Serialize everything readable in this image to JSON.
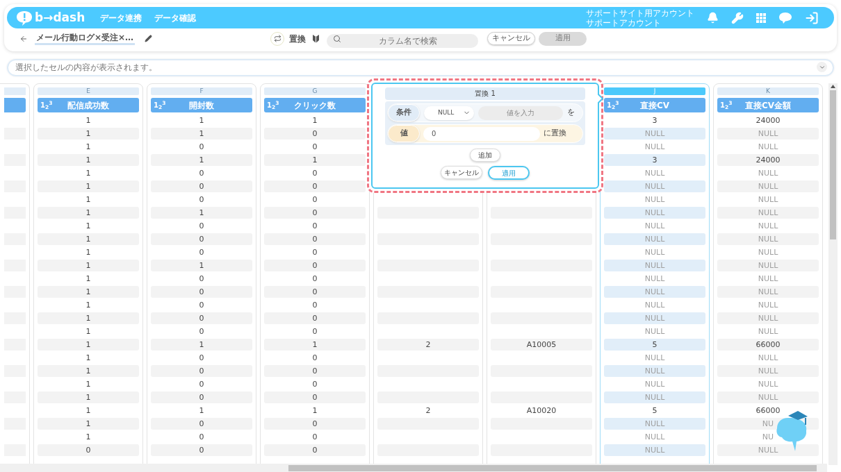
{
  "header": {
    "logo": "b→dash",
    "nav": [
      {
        "label": "データ連携"
      },
      {
        "label": "データ確認"
      }
    ],
    "account": [
      "サポートサイト用アカウント",
      "サポートアカウント"
    ]
  },
  "toolbar": {
    "title": "メール行動ログ×受注×…",
    "replace_label": "置換",
    "search": {
      "placeholder": "カラム名で検索"
    },
    "cancel": "キャンセル",
    "apply": {
      "label": "適用",
      "disabled": true
    }
  },
  "formula_bar": {
    "placeholder": "選択したセルの内容が表示されます。"
  },
  "columns": [
    {
      "letter": "E",
      "name": "配信成功数",
      "type_badge": "1$_{2}$$^{3}$",
      "selected": false,
      "cells": [
        "1",
        "1",
        "1",
        "1",
        "1",
        "1",
        "1",
        "1",
        "1",
        "1",
        "1",
        "1",
        "1",
        "1",
        "1",
        "1",
        "1",
        "1",
        "1",
        "1",
        "1",
        "1",
        "1",
        "1",
        "1",
        "0"
      ]
    },
    {
      "letter": "F",
      "name": "開封数",
      "type_badge": "1$_{2}$$^{3}$",
      "selected": false,
      "cells": [
        "1",
        "1",
        "0",
        "1",
        "0",
        "0",
        "0",
        "1",
        "0",
        "0",
        "0",
        "1",
        "0",
        "0",
        "0",
        "0",
        "0",
        "1",
        "0",
        "0",
        "0",
        "0",
        "1",
        "0",
        "0",
        "0"
      ]
    },
    {
      "letter": "G",
      "name": "クリック数",
      "type_badge": "1$_{2}$$^{3}$",
      "selected": false,
      "cells": [
        "1",
        "0",
        "0",
        "1",
        "0",
        "0",
        "0",
        "0",
        "0",
        "0",
        "0",
        "0",
        "0",
        "0",
        "0",
        "0",
        "0",
        "1",
        "0",
        "0",
        "0",
        "0",
        "1",
        "0",
        "0",
        "0"
      ]
    },
    {
      "selected": false,
      "cells": [
        null,
        null,
        null,
        null,
        null,
        null,
        null,
        null,
        null,
        null,
        null,
        null,
        null,
        null,
        null,
        null,
        null,
        "2",
        null,
        null,
        null,
        null,
        "2",
        null,
        null,
        null
      ]
    },
    {
      "selected": false,
      "cells": [
        null,
        null,
        null,
        null,
        null,
        null,
        null,
        null,
        null,
        null,
        null,
        null,
        null,
        null,
        null,
        null,
        null,
        "A10005",
        null,
        null,
        null,
        null,
        "A10020",
        null,
        null,
        null
      ]
    },
    {
      "letter": "J",
      "name": "直接CV",
      "type_badge": "1$_{2}$$^{3}$",
      "selected": true,
      "cells": [
        {
          "t": "3",
          "null": false
        },
        {
          "t": "NULL",
          "null": true
        },
        {
          "t": "NULL",
          "null": true
        },
        {
          "t": "3",
          "null": false
        },
        {
          "t": "NULL",
          "null": true
        },
        {
          "t": "NULL",
          "null": true
        },
        {
          "t": "NULL",
          "null": true
        },
        {
          "t": "NULL",
          "null": true
        },
        {
          "t": "NULL",
          "null": true
        },
        {
          "t": "NULL",
          "null": true
        },
        {
          "t": "NULL",
          "null": true
        },
        {
          "t": "NULL",
          "null": true
        },
        {
          "t": "NULL",
          "null": true
        },
        {
          "t": "NULL",
          "null": true
        },
        {
          "t": "NULL",
          "null": true
        },
        {
          "t": "NULL",
          "null": true
        },
        {
          "t": "NULL",
          "null": true
        },
        {
          "t": "5",
          "null": false
        },
        {
          "t": "NULL",
          "null": true
        },
        {
          "t": "NULL",
          "null": true
        },
        {
          "t": "NULL",
          "null": true
        },
        {
          "t": "NULL",
          "null": true
        },
        {
          "t": "5",
          "null": false
        },
        {
          "t": "NULL",
          "null": true
        },
        {
          "t": "NULL",
          "null": true
        },
        {
          "t": "NULL",
          "null": true
        }
      ]
    },
    {
      "letter": "K",
      "name": "直接CV金額",
      "type_badge": "1$_{2}$$^{3}$",
      "selected": false,
      "cells": [
        {
          "t": "24000",
          "null": false
        },
        {
          "t": "NULL",
          "null": true
        },
        {
          "t": "NULL",
          "null": true
        },
        {
          "t": "24000",
          "null": false
        },
        {
          "t": "NULL",
          "null": true
        },
        {
          "t": "NULL",
          "null": true
        },
        {
          "t": "NULL",
          "null": true
        },
        {
          "t": "NULL",
          "null": true
        },
        {
          "t": "NULL",
          "null": true
        },
        {
          "t": "NULL",
          "null": true
        },
        {
          "t": "NULL",
          "null": true
        },
        {
          "t": "NULL",
          "null": true
        },
        {
          "t": "NULL",
          "null": true
        },
        {
          "t": "NULL",
          "null": true
        },
        {
          "t": "NULL",
          "null": true
        },
        {
          "t": "NULL",
          "null": true
        },
        {
          "t": "NULL",
          "null": true
        },
        {
          "t": "66000",
          "null": false
        },
        {
          "t": "NULL",
          "null": true
        },
        {
          "t": "NULL",
          "null": true
        },
        {
          "t": "NULL",
          "null": true
        },
        {
          "t": "NULL",
          "null": true
        },
        {
          "t": "66000",
          "null": false
        },
        {
          "t": "NU",
          "null": true
        },
        {
          "t": "NU",
          "null": true
        },
        {
          "t": "NULL",
          "null": true
        }
      ]
    }
  ],
  "replace_popup": {
    "title": "置換 1",
    "condition": {
      "label": "条件",
      "operator": "NULL",
      "placeholder": "値を入力",
      "suffix": "を"
    },
    "value": {
      "label": "値",
      "value": "0",
      "suffix": "に置換"
    },
    "add": "追加",
    "cancel": "キャンセル",
    "apply": "適用"
  }
}
